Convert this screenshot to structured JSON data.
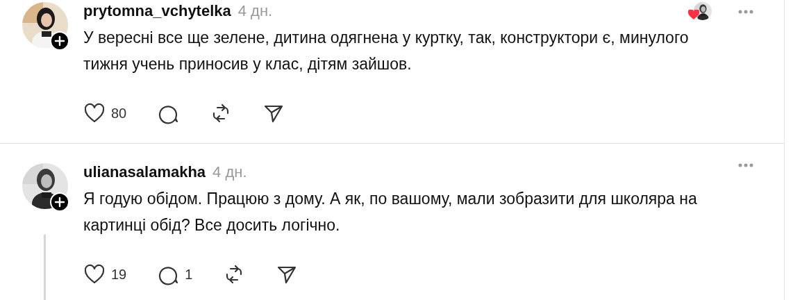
{
  "posts": [
    {
      "username": "prytomna_vchytelka",
      "time": "4 дн.",
      "text": "У вересні все ще зелене, дитина одягнена у куртку, так, конструктори є, минулого тижня учень приносив у клас, дітям зайшов.",
      "likes": "80",
      "liked_by_avatar": true,
      "thread_line": false
    },
    {
      "username": "ulianasalamakha",
      "time": "4 дн.",
      "text": "Я годую обідом. Працюю з дому. А як, по вашому, мали зобразити для школяра на картинці обід? Все досить логічно.",
      "likes": "19",
      "replies": "1",
      "liked_by_avatar": false,
      "thread_line": true
    }
  ]
}
